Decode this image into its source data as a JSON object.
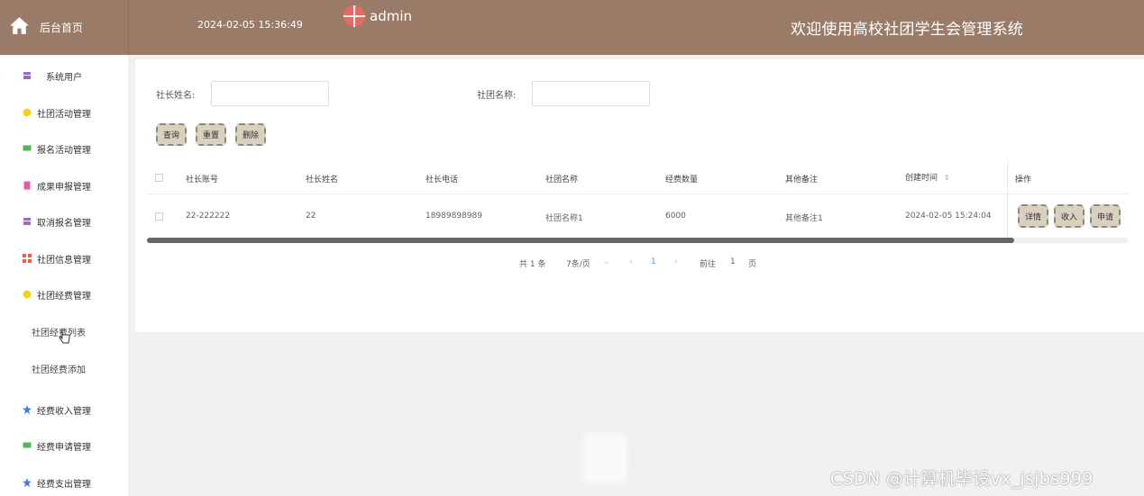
{
  "header": {
    "home_label": "后台首页",
    "datetime": "2024-02-05 15:36:49",
    "username": "admin",
    "system_title": "欢迎使用高校社团学生会管理系统",
    "bg_color": "#9a7b68"
  },
  "sidebar": {
    "items": [
      {
        "label": "系统用户",
        "icon": "user-icon",
        "color": "#9b6cc2"
      },
      {
        "label": "社团活动管理",
        "icon": "smile-icon",
        "color": "#f2d51a"
      },
      {
        "label": "报名活动管理",
        "icon": "message-icon",
        "color": "#57b35c"
      },
      {
        "label": "成果申报管理",
        "icon": "document-icon",
        "color": "#e35fa3"
      },
      {
        "label": "取消报名管理",
        "icon": "user-icon",
        "color": "#9b6cc2"
      },
      {
        "label": "社团信息管理",
        "icon": "grid-icon",
        "color": "#ef5a4a"
      },
      {
        "label": "社团经费管理",
        "icon": "smile-icon",
        "color": "#f2d51a"
      },
      {
        "label": "经费收入管理",
        "icon": "star-icon",
        "color": "#3d7be3"
      },
      {
        "label": "经费申请管理",
        "icon": "message-icon",
        "color": "#57b35c"
      },
      {
        "label": "经费支出管理",
        "icon": "star-icon",
        "color": "#3d7be3"
      }
    ],
    "sub_items": [
      {
        "label": "社团经费列表"
      },
      {
        "label": "社团经费添加"
      }
    ]
  },
  "search": {
    "leader_name_label": "社长姓名:",
    "leader_name_value": "",
    "club_name_label": "社团名称:",
    "club_name_value": "",
    "query_btn": "查询",
    "reset_btn": "重置",
    "delete_btn": "删除"
  },
  "table": {
    "headers": [
      "社长账号",
      "社长姓名",
      "社长电话",
      "社团名称",
      "经费数量",
      "其他备注",
      "创建时间",
      "操作"
    ],
    "sort_icon": "⇕",
    "rows": [
      {
        "account": "22-222222",
        "name": "22",
        "phone": "18989898989",
        "club": "社团名称1",
        "amount": "6000",
        "remark": "其他备注1",
        "created": "2024-02-05 15:24:04"
      }
    ],
    "actions": [
      "详情",
      "收入",
      "申请"
    ]
  },
  "pagination": {
    "total": "共 1 条",
    "page_size": "7条/页",
    "prev": "‹",
    "page": "1",
    "next": "›",
    "goto_label": "前往",
    "goto_value": "1",
    "page_unit": "页"
  },
  "watermark": "CSDN @计算机毕设vx_jsjbs999"
}
